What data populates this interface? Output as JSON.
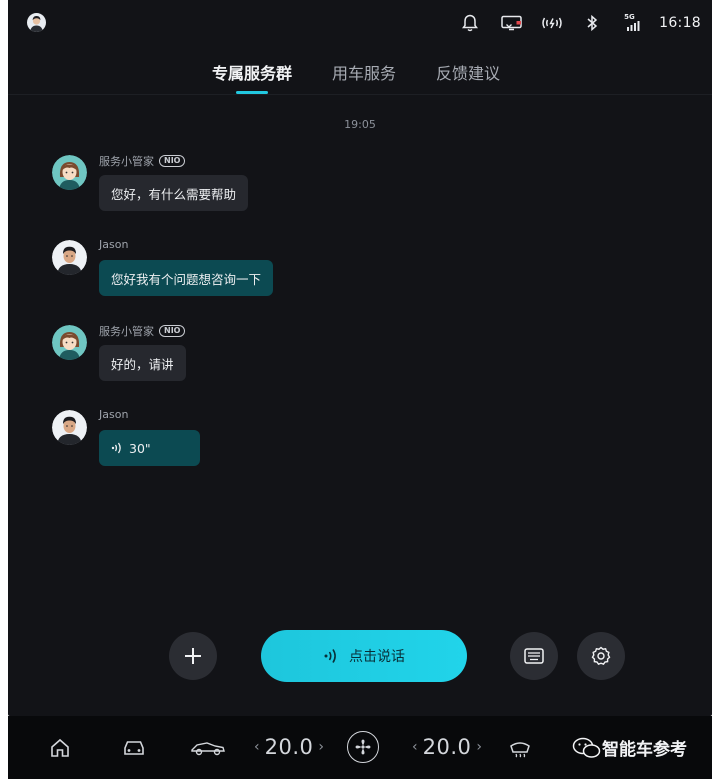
{
  "status_bar": {
    "time": "16:18",
    "signal_label": "5G",
    "icons": [
      "user-avatar",
      "bell-icon",
      "screen-cast-icon",
      "wireless-icon",
      "bluetooth-icon",
      "cellular-5g-icon"
    ]
  },
  "tabs": [
    {
      "label": "专属服务群",
      "active": true
    },
    {
      "label": "用车服务",
      "active": false
    },
    {
      "label": "反馈建议",
      "active": false
    }
  ],
  "chat": {
    "timestamp": "19:05",
    "messages": [
      {
        "sender": "服务小管家",
        "badge": "NIO",
        "text": "您好，有什么需要帮助",
        "direction": "in"
      },
      {
        "sender": "Jason",
        "text": "您好我有个问题想咨询一下",
        "direction": "out"
      },
      {
        "sender": "服务小管家",
        "badge": "NIO",
        "text": "好的，请讲",
        "direction": "in"
      },
      {
        "sender": "Jason",
        "voice_duration": "30\"",
        "direction": "out"
      }
    ]
  },
  "controls": {
    "talk_label": "点击说话",
    "accent": "#22c8e0"
  },
  "dock": {
    "temp_left": "20.0",
    "temp_right": "20.0",
    "chev_left": "‹",
    "chev_right": "›",
    "watermark": "智能车参考"
  }
}
